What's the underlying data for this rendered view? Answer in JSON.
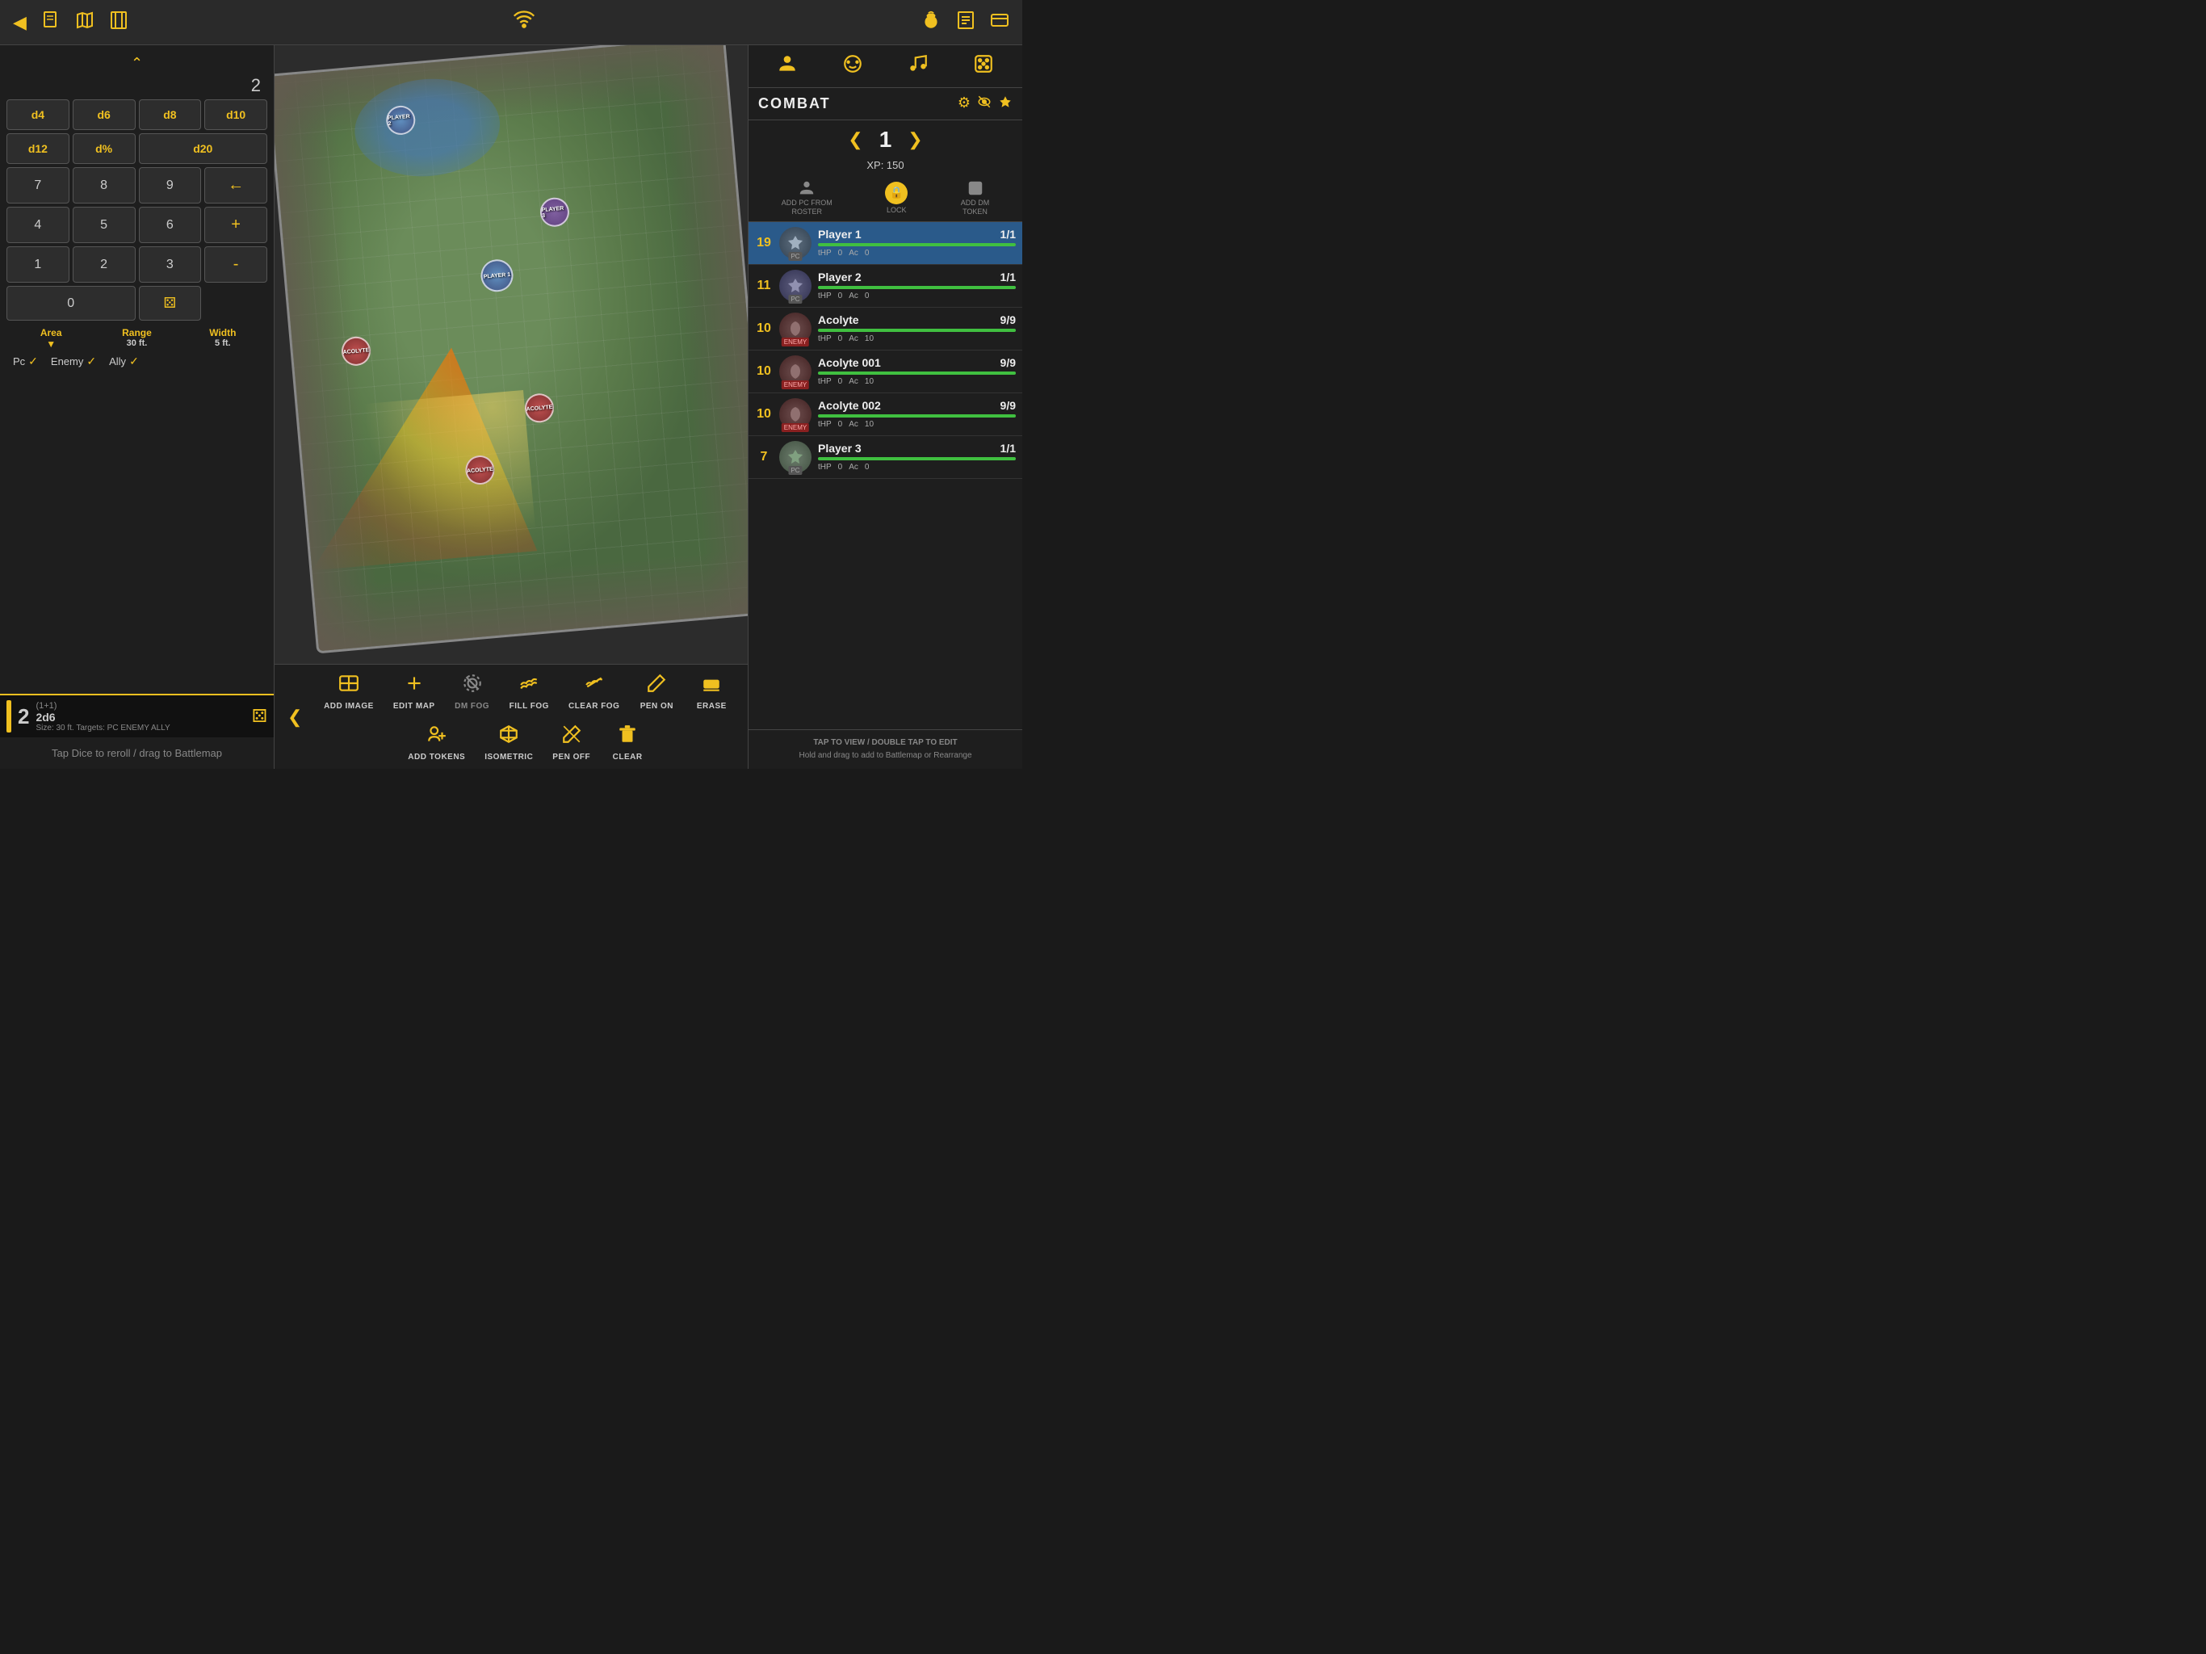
{
  "topbar": {
    "left_icons": [
      "back-arrow",
      "new-doc",
      "map",
      "bookmark"
    ],
    "center_icon": "wifi",
    "right_icons": [
      "token-bag",
      "notes",
      "card"
    ]
  },
  "dice": {
    "count": "2",
    "dice_types": [
      {
        "label": "d4",
        "id": "d4"
      },
      {
        "label": "d6",
        "id": "d6"
      },
      {
        "label": "d8",
        "id": "d8"
      },
      {
        "label": "d10",
        "id": "d10"
      },
      {
        "label": "d12",
        "id": "d12",
        "wide": false
      },
      {
        "label": "d%",
        "id": "dpercent",
        "wide": false
      },
      {
        "label": "d20",
        "id": "d20",
        "wide": true
      }
    ],
    "numpad": [
      "7",
      "8",
      "9",
      "←",
      "4",
      "5",
      "6",
      "+",
      "1",
      "2",
      "3",
      "-",
      "0",
      "⚄"
    ],
    "area_label": "Area",
    "range_label": "Range",
    "range_value": "30 ft.",
    "width_label": "Width",
    "width_value": "5 ft.",
    "targets": [
      "Pc",
      "Enemy",
      "Ally"
    ],
    "roll_result": "2",
    "roll_formula": "(1+1)",
    "roll_dice": "2d6",
    "roll_size": "Size: 30 ft. Targets: PC ENEMY ALLY",
    "hint": "Tap Dice to reroll / drag to Battlemap"
  },
  "bottom_toolbar": {
    "items": [
      {
        "icon": "⊞",
        "label": "Add Image",
        "id": "add-image"
      },
      {
        "icon": "✚",
        "label": "Edit Map",
        "id": "edit-map"
      },
      {
        "icon": "👁",
        "label": "DM FOG",
        "id": "dm-fog",
        "dim": true
      },
      {
        "icon": "☁",
        "label": "Fill Fog",
        "id": "fill-fog"
      },
      {
        "icon": "✏",
        "label": "Clear Fog",
        "id": "clear-fog"
      },
      {
        "icon": "✏",
        "label": "Pen On",
        "id": "pen-on"
      },
      {
        "icon": "⊟",
        "label": "Erase",
        "id": "erase"
      },
      {
        "icon": "👤",
        "label": "Add Tokens",
        "id": "add-tokens"
      },
      {
        "icon": "◈",
        "label": "Isometric",
        "id": "isometric"
      },
      {
        "icon": "✏",
        "label": "Pen Off",
        "id": "pen-off"
      },
      {
        "icon": "⊟",
        "label": "Clear",
        "id": "clear"
      }
    ]
  },
  "combat": {
    "title": "COMBAT",
    "turn": "1",
    "xp": "XP: 150",
    "add_pc_label": "ADD PC FROM\nROSTER",
    "lock_label": "LOCK",
    "add_dm_label": "ADD DM\nTOKEN",
    "combatants": [
      {
        "init": "19",
        "name": "Player 1",
        "fraction": "1/1",
        "type": "PC",
        "hp_bar": 100,
        "thp": "0",
        "ac": "0",
        "active": true,
        "dot": "yellow"
      },
      {
        "init": "11",
        "name": "Player 2",
        "fraction": "1/1",
        "type": "PC",
        "hp_bar": 100,
        "thp": "0",
        "ac": "0",
        "active": false,
        "dot": "yellow"
      },
      {
        "init": "10",
        "name": "Acolyte",
        "fraction": "9/9",
        "type": "ENEMY",
        "hp_bar": 100,
        "thp": "0",
        "ac": "10",
        "active": false,
        "dot": "yellow"
      },
      {
        "init": "10",
        "name": "Acolyte 001",
        "fraction": "9/9",
        "type": "ENEMY",
        "hp_bar": 100,
        "thp": "0",
        "ac": "10",
        "active": false,
        "dot": "yellow"
      },
      {
        "init": "10",
        "name": "Acolyte 002",
        "fraction": "9/9",
        "type": "ENEMY",
        "hp_bar": 100,
        "thp": "0",
        "ac": "10",
        "active": false,
        "dot": "yellow"
      },
      {
        "init": "7",
        "name": "Player 3",
        "fraction": "1/1",
        "type": "PC",
        "hp_bar": 100,
        "thp": "0",
        "ac": "0",
        "active": false,
        "dot": "pink"
      }
    ],
    "footer_hint": "Tap to VIEW / Double Tap to EDIT\nHold and drag to add to Battlemap or Rearrange"
  },
  "right_tabs": {
    "icons": [
      "person",
      "gamepad",
      "music",
      "dice"
    ]
  }
}
